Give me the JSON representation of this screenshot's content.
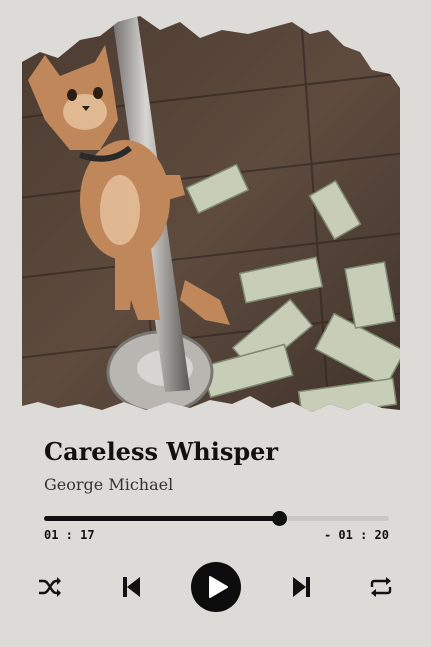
{
  "track": {
    "title": "Careless Whisper",
    "artist": "George Michael"
  },
  "playback": {
    "elapsed": "01 : 17",
    "remaining": "- 01 : 20",
    "progress_fraction": 0.68
  },
  "controls": {
    "shuffle_icon": "shuffle-icon",
    "previous_icon": "skip-previous-icon",
    "play_icon": "play-icon",
    "next_icon": "skip-next-icon",
    "repeat_icon": "repeat-icon"
  },
  "colors": {
    "background": "#dcdbd8",
    "accent": "#111111",
    "track_bg": "#c9c8c5"
  }
}
